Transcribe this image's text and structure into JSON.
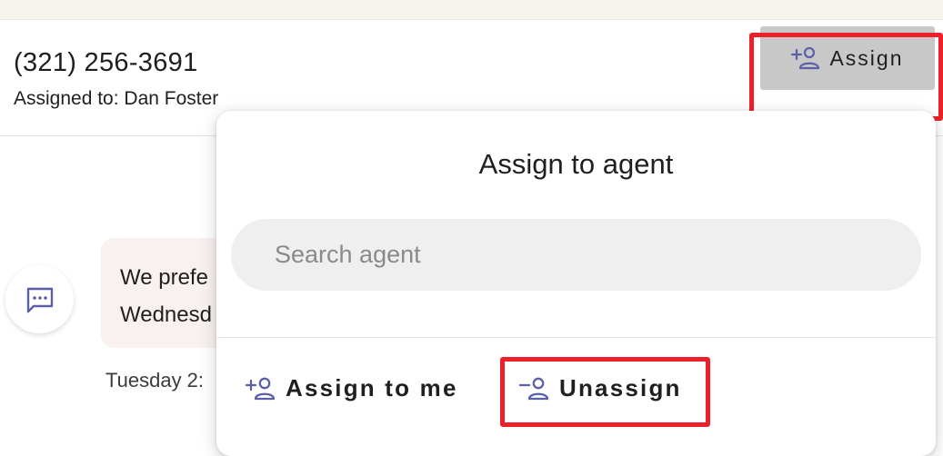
{
  "header": {
    "phone": "(321) 256-3691",
    "assigned_to": "Assigned to: Dan Foster",
    "assign_button": "Assign"
  },
  "conversation": {
    "message_preview_line1": "We prefe",
    "message_preview_line2": "Wednesd",
    "timestamp": "Tuesday 2:"
  },
  "assign_popup": {
    "title": "Assign to agent",
    "search_placeholder": "Search agent",
    "search_value": "",
    "assign_to_me": "Assign to me",
    "unassign": "Unassign"
  },
  "icons": {
    "assign": "person-add-icon",
    "assign_to_me": "person-add-icon",
    "unassign": "person-remove-icon",
    "chat": "chat-bubble-icon"
  },
  "colors": {
    "icon_accent": "#5b5fa8",
    "highlight": "#f0202a",
    "assign_button_bg": "#c8c8c8"
  }
}
